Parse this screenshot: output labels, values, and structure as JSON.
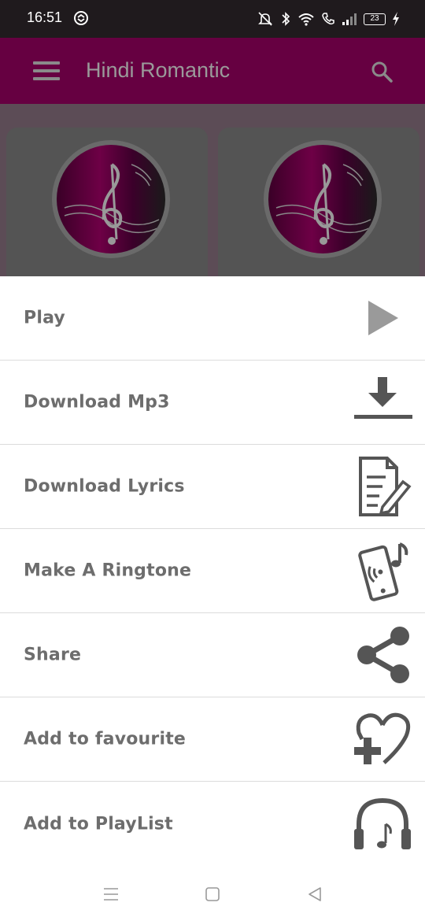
{
  "status_bar": {
    "time": "16:51",
    "battery_level": "23",
    "icons": [
      "mute-bell-icon",
      "bluetooth-icon",
      "wifi-icon",
      "call-icon",
      "signal-icon",
      "battery-icon",
      "charging-icon"
    ]
  },
  "app_bar": {
    "title": "Hindi Romantic",
    "menu_icon": "menu-icon",
    "search_icon": "search-icon"
  },
  "colors": {
    "app_bar": "#660041",
    "overlay_content": "#5c4c56",
    "icon_gray": "#555555",
    "label_gray": "#6d6d6d"
  },
  "options": [
    {
      "label": "Play",
      "icon": "play-icon"
    },
    {
      "label": "Download Mp3",
      "icon": "download-icon"
    },
    {
      "label": "Download Lyrics",
      "icon": "lyrics-document-icon"
    },
    {
      "label": "Make A Ringtone",
      "icon": "ringtone-phone-icon"
    },
    {
      "label": "Share",
      "icon": "share-icon"
    },
    {
      "label": "Add to favourite",
      "icon": "heart-plus-icon"
    },
    {
      "label": "Add to PlayList",
      "icon": "headphones-music-icon"
    }
  ],
  "nav_bar": {
    "buttons": [
      "recents-menu-icon",
      "home-square-icon",
      "back-triangle-icon"
    ]
  }
}
